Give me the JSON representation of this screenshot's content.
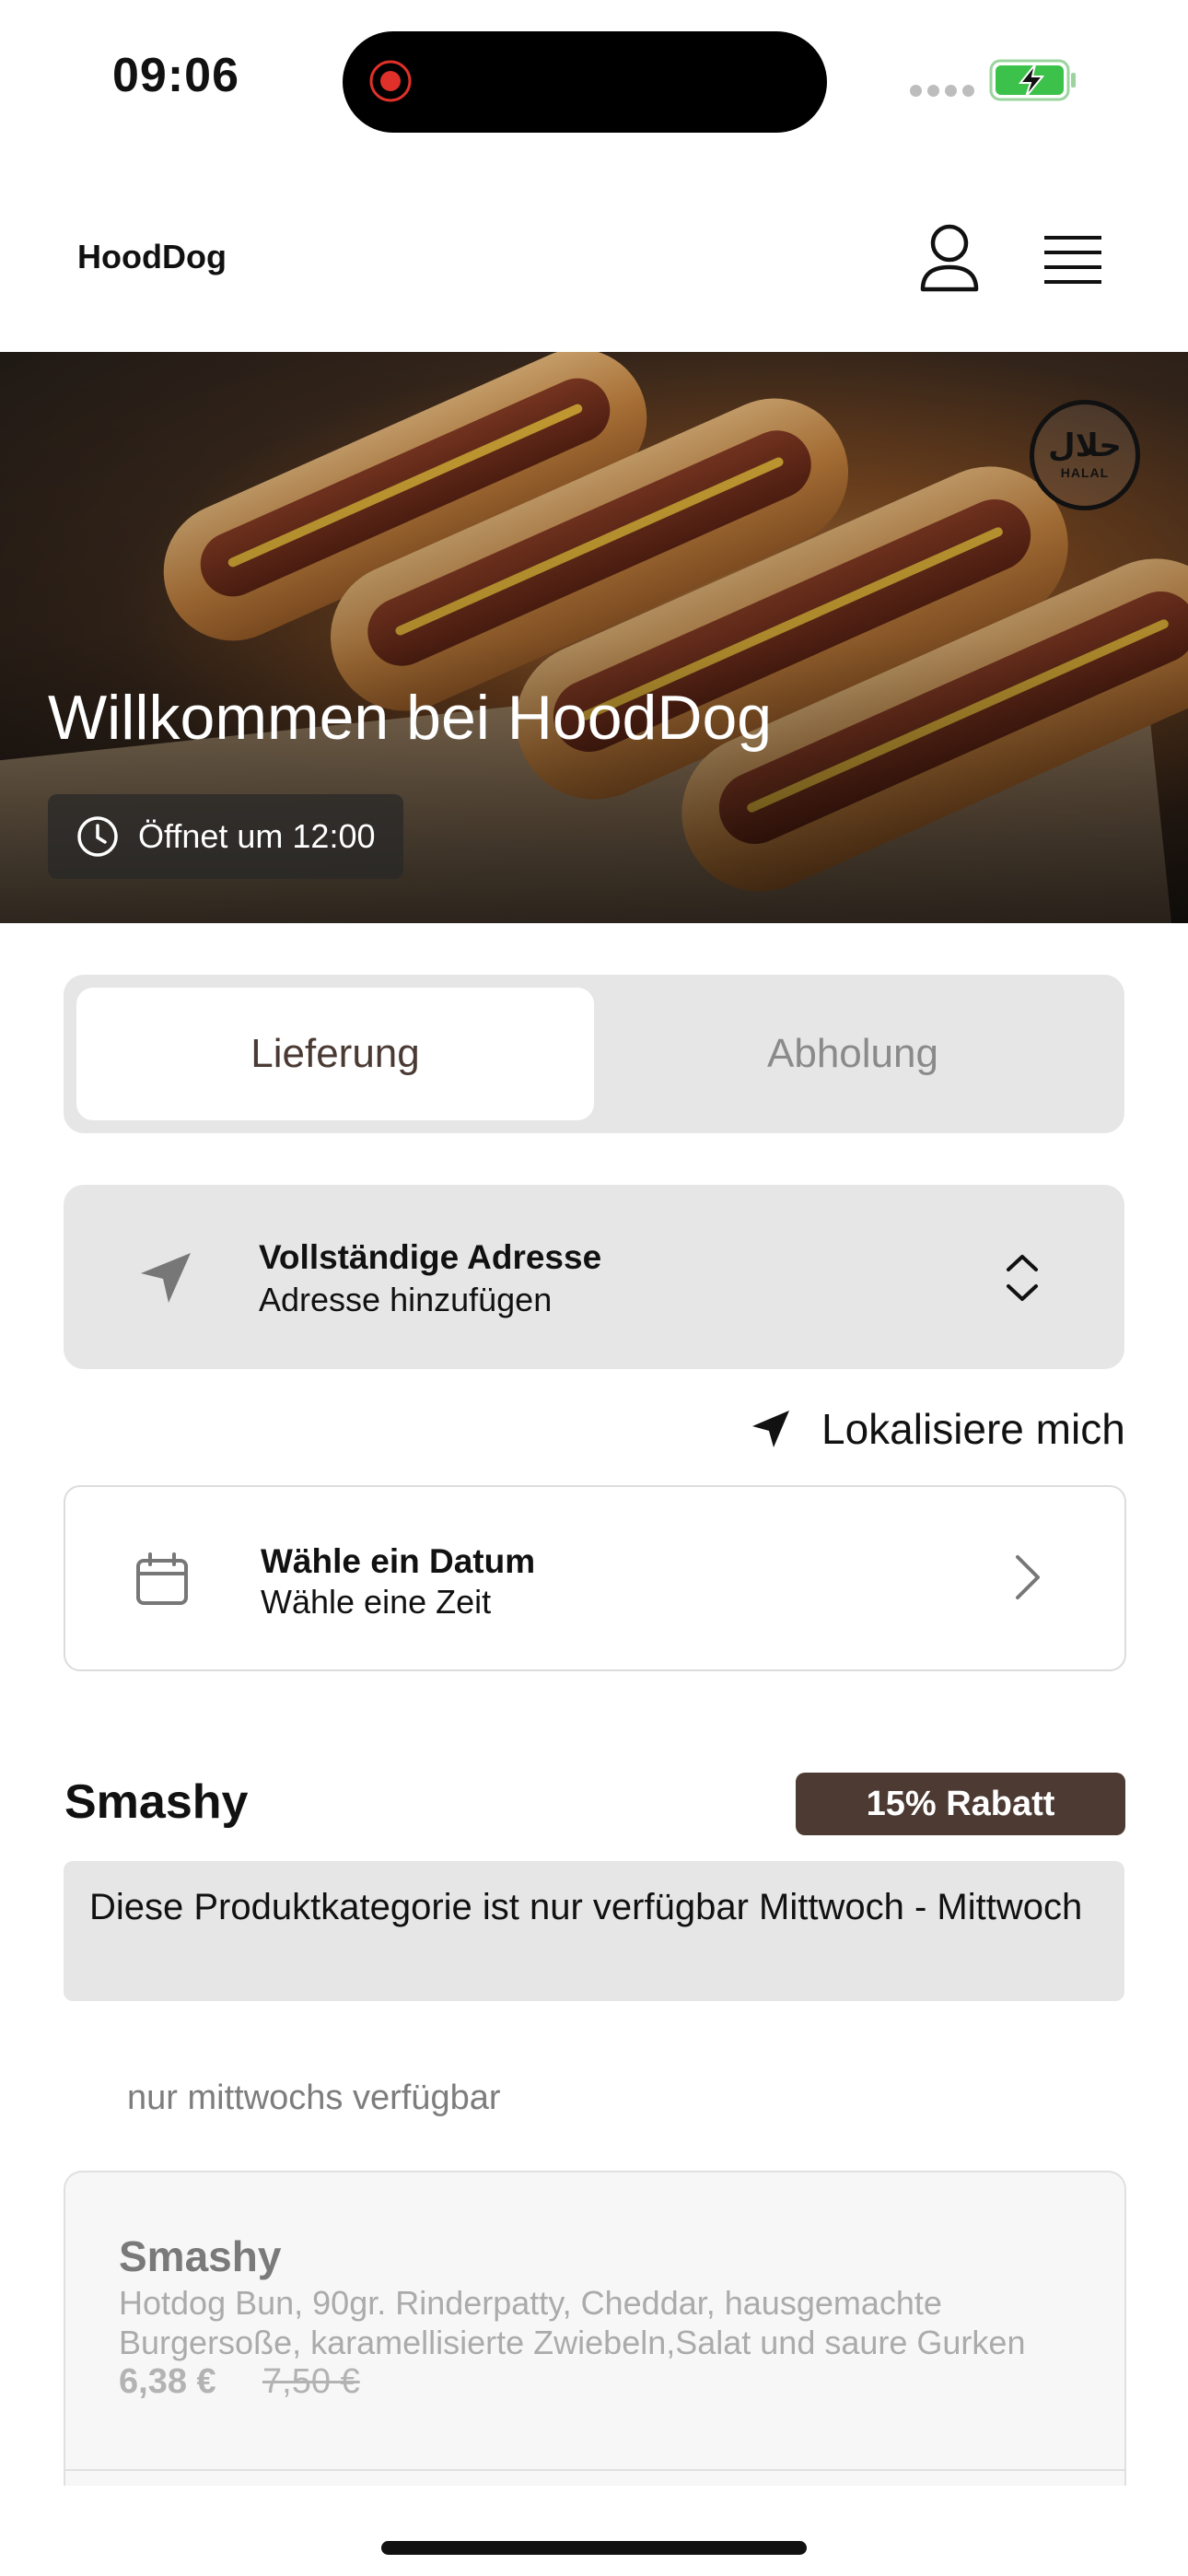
{
  "status_bar": {
    "time": "09:06",
    "battery_color": "#3cc24a"
  },
  "header": {
    "brand": "HoodDog",
    "user_icon": "user-icon",
    "menu_icon": "hamburger-icon"
  },
  "hero": {
    "title": "Willkommen bei HoodDog",
    "hours": "Öffnet um 12:00",
    "badge_arabic": "حلال",
    "badge_text": "HALAL"
  },
  "mode_tabs": {
    "delivery": "Lieferung",
    "pickup": "Abholung",
    "selected": "Lieferung"
  },
  "address": {
    "title": "Vollständige Adresse",
    "subtitle": "Adresse hinzufügen"
  },
  "locate": {
    "label": "Lokalisiere mich"
  },
  "date": {
    "title": "Wähle ein Datum",
    "subtitle": "Wähle eine Zeit"
  },
  "category": {
    "title": "Smashy",
    "badge": "15% Rabatt",
    "notice": "Diese Produktkategorie ist nur verfügbar Mittwoch - Mittwoch",
    "availability": "nur mittwochs verfügbar"
  },
  "product": {
    "name": "Smashy",
    "description": "Hotdog Bun, 90gr. Rinderpatty, Cheddar, hausgemachte Burgersoße, karamellisierte Zwiebeln,Salat und saure Gurken",
    "price": "6,38 €",
    "old_price": "7,50 €"
  },
  "colors": {
    "accent": "#4c3a33",
    "card_bg": "#e6e6e6"
  }
}
